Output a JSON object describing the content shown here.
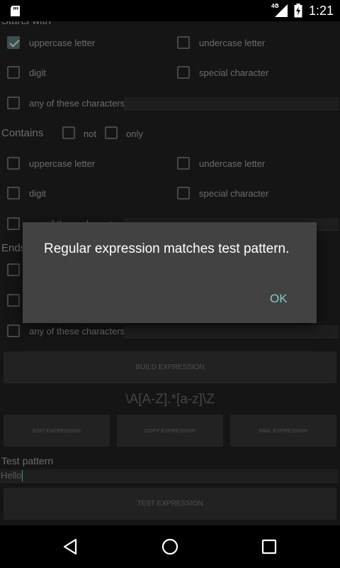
{
  "status_bar": {
    "time": "1:21",
    "network": "4G"
  },
  "starts_with": {
    "heading": "Starts with",
    "uppercase": {
      "label": "uppercase letter",
      "checked": true
    },
    "undercase": {
      "label": "undercase letter",
      "checked": false
    },
    "digit": {
      "label": "digit",
      "checked": false
    },
    "special": {
      "label": "special character",
      "checked": false
    },
    "any_chars": {
      "label": "any of these characters",
      "value": ""
    }
  },
  "contains": {
    "heading": "Contains",
    "not_label": "not",
    "only_label": "only",
    "uppercase": {
      "label": "uppercase letter"
    },
    "undercase": {
      "label": "undercase letter"
    },
    "digit": {
      "label": "digit"
    },
    "special": {
      "label": "special character"
    },
    "any_chars": {
      "label": "any of these characters",
      "value": ""
    }
  },
  "ends_with": {
    "heading": "Ends with",
    "any_chars": {
      "label": "any of these characters",
      "value": ""
    }
  },
  "actions": {
    "build": "BUILD EXPRESSION",
    "edit": "EDIT EXPRESSION",
    "copy": "COPY EXPRESSION",
    "mail": "MAIL EXPRESSION",
    "test": "TEST EXPRESSION"
  },
  "expression": "\\A[A-Z].*[a-z]\\Z",
  "test_pattern": {
    "label": "Test pattern",
    "value": "Hello"
  },
  "dialog": {
    "message": "Regular expression matches test pattern.",
    "ok_label": "OK"
  },
  "colors": {
    "background": "#212121",
    "dialog": "#424242",
    "accent": "#80cbc4"
  }
}
